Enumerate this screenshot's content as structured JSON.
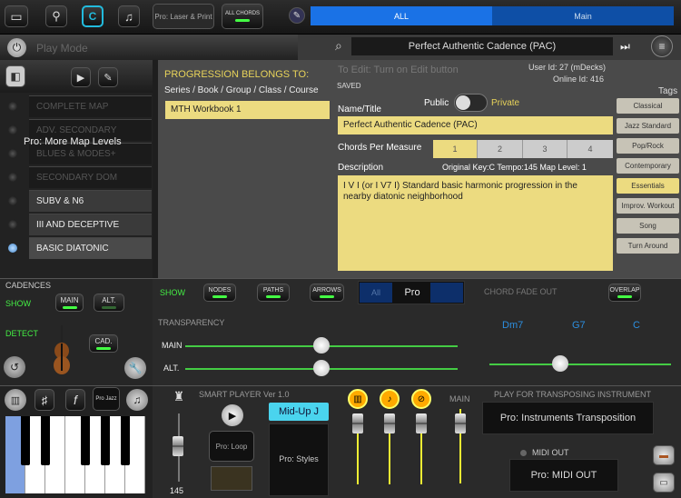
{
  "toolbar": {
    "pro_laser": "Pro: Laser & Print",
    "all_chords": "ALL CHORDS",
    "filter_all": "ALL",
    "filter_main": "Main",
    "c_label": "C"
  },
  "playbar": {
    "mode_label": "Play Mode",
    "progression_title": "Perfect Authentic Cadence (PAC)"
  },
  "map": {
    "items": [
      {
        "label": "COMPLETE MAP",
        "dim": true
      },
      {
        "label": "ADV. SECONDARY",
        "dim": true
      },
      {
        "label": "BLUES & MODES+",
        "dim": true
      },
      {
        "label": "SECONDARY DOM",
        "dim": true
      },
      {
        "label": "SUBV & N6",
        "dim": false
      },
      {
        "label": "III AND DECEPTIVE",
        "dim": false
      },
      {
        "label": "BASIC DIATONIC",
        "dim": false
      }
    ],
    "pro_overlay": "Pro: More Map Levels"
  },
  "editor": {
    "belongs_heading": "PROGRESSION BELONGS TO:",
    "hierarchy": "Series / Book / Group / Class / Course",
    "belongs_value": "MTH Workbook 1",
    "edit_hint": "To Edit: Turn on Edit button",
    "saved": "SAVED",
    "user_id": "User Id: 27 (mDecks)",
    "online_id": "Online Id: 416",
    "public": "Public",
    "private": "Private",
    "name_label": "Name/Title",
    "name_value": "Perfect Authentic Cadence (PAC)",
    "cpm_label": "Chords Per Measure",
    "cpm": [
      "1",
      "2",
      "3",
      "4"
    ],
    "desc_label": "Description",
    "desc_meta": "Original Key:C Tempo:145 Map Level: 1",
    "desc_value": "I V I (or I V7 I) Standard basic harmonic progression in the nearby diatonic neighborhood"
  },
  "tags": {
    "heading": "Tags",
    "items": [
      "Classical",
      "Jazz Standard",
      "Pop/Rock",
      "Contemporary",
      "Essentials",
      "Improv. Workout",
      "Song",
      "Turn Around"
    ],
    "selected": "Essentials"
  },
  "cadences": {
    "heading": "CADENCES",
    "show": "SHOW",
    "detect": "DETECT",
    "main": "MAIN",
    "alt": "ALT.",
    "cad": "CAD."
  },
  "display": {
    "show": "SHOW",
    "nodes": "NODES",
    "paths": "PATHS",
    "arrows": "ARROWS",
    "all": "All",
    "pro": "Pro",
    "chord_fade": "CHORD FADE OUT",
    "overlap": "OVERLAP",
    "transparency": "TRANSPARENCY",
    "main": "MAIN",
    "alt": "ALT.",
    "chords": [
      "Dm7",
      "G7",
      "C"
    ]
  },
  "player": {
    "title": "SMART PLAYER Ver 1.0",
    "style": "Mid-Up J",
    "pro_loop": "Pro: Loop",
    "pro_styles": "Pro: Styles",
    "tempo": "145",
    "main": "MAIN",
    "transpose_heading": "PLAY FOR TRANSPOSING INSTRUMENT",
    "pro_transpose": "Pro: Instruments Transposition",
    "midi_out": "MIDI OUT",
    "pro_midi": "Pro: MIDI OUT",
    "pro_jazz": "Pro Jazz",
    "sax_glyph": "♯",
    "f_glyph": "f",
    "note_glyph": "♫",
    "pause_glyph": "⏯"
  }
}
